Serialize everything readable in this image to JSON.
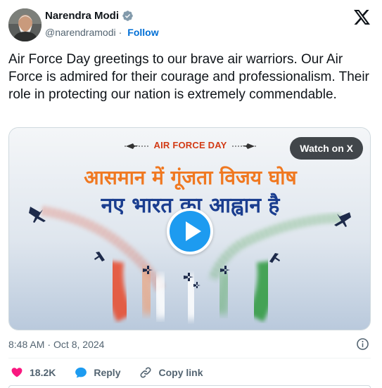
{
  "author": {
    "name": "Narendra Modi",
    "handle": "@narendramodi",
    "separator": "·",
    "follow_label": "Follow"
  },
  "tweet": {
    "text": "Air Force Day greetings to our brave air warriors. Our Air Force is admired for their courage and professionalism. Their role in protecting our nation is extremely commendable."
  },
  "media": {
    "banner_text": "AIR FORCE DAY",
    "hindi_line_1": "आसमान में गूंजता विजय घोष",
    "hindi_line_2": "नए भारत का आह्वान है",
    "watch_label": "Watch on X"
  },
  "meta": {
    "time": "8:48 AM",
    "separator": "·",
    "date": "Oct 8, 2024"
  },
  "actions": {
    "like_count": "18.2K",
    "reply_label": "Reply",
    "copy_link_label": "Copy link"
  },
  "colors": {
    "accent_blue": "#1d9bf0",
    "like_red": "#f91880",
    "saffron": "#f07820",
    "india_green": "#2e8b3a",
    "navy_text": "#1a3d8f"
  },
  "icons": {
    "verified": "verified-badge-icon",
    "x_logo": "x-logo-icon",
    "play": "play-icon",
    "info": "info-icon",
    "like": "heart-icon",
    "reply": "reply-bubble-icon",
    "copy_link": "link-icon"
  }
}
